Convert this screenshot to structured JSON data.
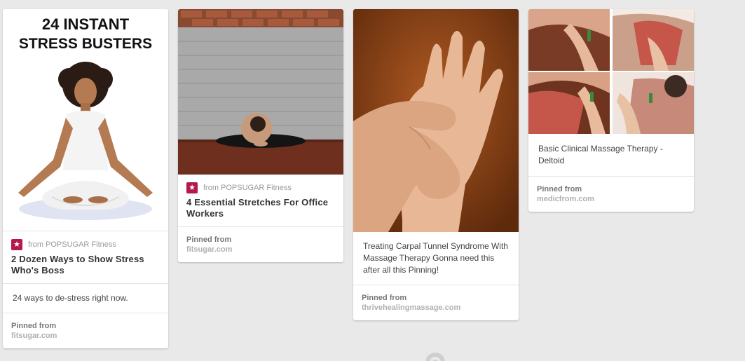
{
  "pins": [
    {
      "image_alt": "24 INSTANT STRESS BUSTERS",
      "image_headline_1": "24 INSTANT",
      "image_headline_2": "STRESS BUSTERS",
      "source_prefix": "from",
      "source_name": "POPSUGAR Fitness",
      "source_icon": "star-icon",
      "title": "2 Dozen Ways to Show Stress Who's Boss",
      "description": "24 ways to de-stress right now.",
      "pinned_label": "Pinned from",
      "pinned_domain": "fitsugar.com"
    },
    {
      "source_prefix": "from",
      "source_name": "POPSUGAR Fitness",
      "source_icon": "star-icon",
      "title": "4 Essential Stretches For Office Workers",
      "pinned_label": "Pinned from",
      "pinned_domain": "fitsugar.com"
    },
    {
      "description": "Treating Carpal Tunnel Syndrome With Massage Therapy Gonna need this after all this Pinning!",
      "pinned_label": "Pinned from",
      "pinned_domain": "thrivehealingmassage.com"
    },
    {
      "description": "Basic Clinical Massage Therapy - Deltoid",
      "pinned_label": "Pinned from",
      "pinned_domain": "medicfrom.com"
    }
  ],
  "colors": {
    "background": "#e9e9e9",
    "source_logo": "#b5174f"
  },
  "loading_indicator": "spinner-icon"
}
